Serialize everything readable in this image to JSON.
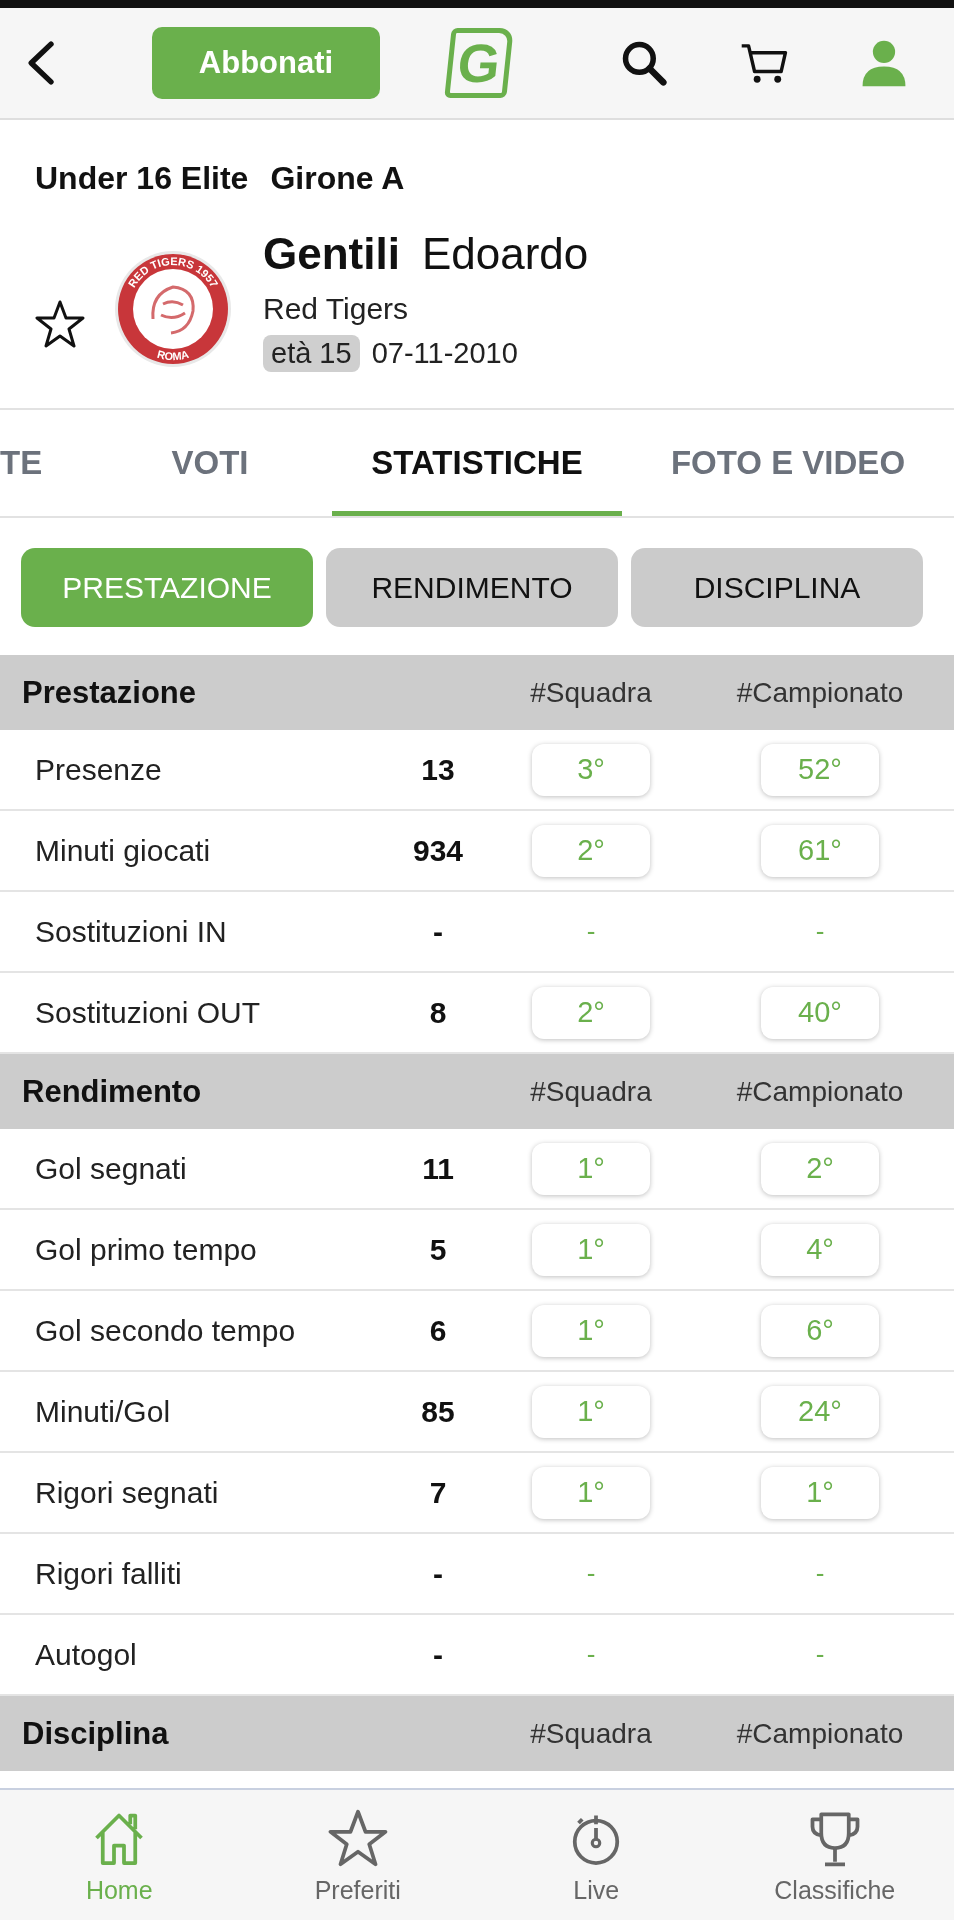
{
  "header": {
    "subscribe_button": "Abbonati",
    "logo": "G"
  },
  "competition": {
    "league": "Under 16 Elite",
    "group": "Girone A"
  },
  "player": {
    "favorite": false,
    "surname": "Gentili",
    "name": "Edoardo",
    "team": "Red Tigers",
    "crest_top": "RED TIGERS 1957",
    "crest_bottom": "ROMA",
    "age": "età 15",
    "birth_date": "07-11-2010"
  },
  "tabs": [
    {
      "label": "TE",
      "selected": false
    },
    {
      "label": "VOTI",
      "selected": false
    },
    {
      "label": "STATISTICHE",
      "selected": true
    },
    {
      "label": "FOTO E VIDEO",
      "selected": false
    }
  ],
  "filters": [
    {
      "label": "PRESTAZIONE",
      "selected": true
    },
    {
      "label": "RENDIMENTO",
      "selected": false
    },
    {
      "label": "DISCIPLINA",
      "selected": false
    }
  ],
  "sections": [
    {
      "title": "Prestazione",
      "team_column": "#Squadra",
      "league_column": "#Campionato",
      "rows": [
        {
          "label": "Presenze",
          "value": "13",
          "ranked": true,
          "team_rank": "3°",
          "league_rank": "52°"
        },
        {
          "label": "Minuti giocati",
          "value": "934",
          "ranked": true,
          "team_rank": "2°",
          "league_rank": "61°"
        },
        {
          "label": "Sostituzioni IN",
          "value": "-",
          "ranked": false,
          "team_rank": "-",
          "league_rank": "-"
        },
        {
          "label": "Sostituzioni OUT",
          "value": "8",
          "ranked": true,
          "team_rank": "2°",
          "league_rank": "40°"
        }
      ]
    },
    {
      "title": "Rendimento",
      "team_column": "#Squadra",
      "league_column": "#Campionato",
      "rows": [
        {
          "label": "Gol segnati",
          "value": "11",
          "ranked": true,
          "team_rank": "1°",
          "league_rank": "2°"
        },
        {
          "label": "Gol primo tempo",
          "value": "5",
          "ranked": true,
          "team_rank": "1°",
          "league_rank": "4°"
        },
        {
          "label": "Gol secondo tempo",
          "value": "6",
          "ranked": true,
          "team_rank": "1°",
          "league_rank": "6°"
        },
        {
          "label": "Minuti/Gol",
          "value": "85",
          "ranked": true,
          "team_rank": "1°",
          "league_rank": "24°"
        },
        {
          "label": "Rigori segnati",
          "value": "7",
          "ranked": true,
          "team_rank": "1°",
          "league_rank": "1°"
        },
        {
          "label": "Rigori falliti",
          "value": "-",
          "ranked": false,
          "team_rank": "-",
          "league_rank": "-"
        },
        {
          "label": "Autogol",
          "value": "-",
          "ranked": false,
          "team_rank": "-",
          "league_rank": "-"
        }
      ]
    },
    {
      "title": "Disciplina",
      "team_column": "#Squadra",
      "league_column": "#Campionato"
    }
  ],
  "bottom_nav": [
    {
      "label": "Home",
      "selected": true
    },
    {
      "label": "Preferiti",
      "selected": false
    },
    {
      "label": "Live",
      "selected": false
    },
    {
      "label": "Classifiche",
      "selected": false
    }
  ]
}
